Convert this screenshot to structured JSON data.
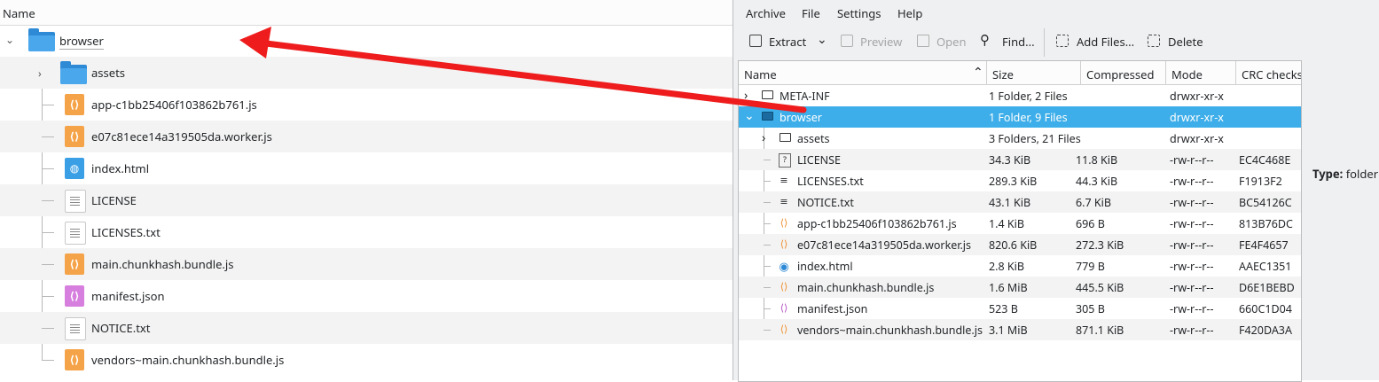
{
  "left_pane": {
    "header": "Name",
    "rows": [
      {
        "name": "browser",
        "kind": "folder"
      },
      {
        "name": "assets",
        "kind": "folder"
      },
      {
        "name": "app-c1bb25406f103862b761.js",
        "kind": "js"
      },
      {
        "name": "e07c81ece14a319505da.worker.js",
        "kind": "js"
      },
      {
        "name": "index.html",
        "kind": "html"
      },
      {
        "name": "LICENSE",
        "kind": "txt"
      },
      {
        "name": "LICENSES.txt",
        "kind": "txt"
      },
      {
        "name": "main.chunkhash.bundle.js",
        "kind": "js"
      },
      {
        "name": "manifest.json",
        "kind": "json"
      },
      {
        "name": "NOTICE.txt",
        "kind": "txt"
      },
      {
        "name": "vendors~main.chunkhash.bundle.js",
        "kind": "js"
      }
    ]
  },
  "ark": {
    "menu": [
      "Archive",
      "File",
      "Settings",
      "Help"
    ],
    "toolbar": {
      "extract": "Extract",
      "preview": "Preview",
      "open": "Open",
      "find": "Find...",
      "add_files": "Add Files...",
      "delete": "Delete"
    },
    "columns": [
      "Name",
      "Size",
      "Compressed",
      "Mode",
      "CRC checksu"
    ],
    "rows": [
      {
        "name": "META-INF",
        "size": "1 Folder, 2 Files",
        "compressed": "",
        "mode": "drwxr-xr-x",
        "crc": "",
        "kind": "folder"
      },
      {
        "name": "browser",
        "size": "1 Folder, 9 Files",
        "compressed": "",
        "mode": "drwxr-xr-x",
        "crc": "",
        "kind": "folder"
      },
      {
        "name": "assets",
        "size": "3 Folders, 21 Files",
        "compressed": "",
        "mode": "drwxr-xr-x",
        "crc": "",
        "kind": "folder"
      },
      {
        "name": "LICENSE",
        "size": "34.3 KiB",
        "compressed": "11.8 KiB",
        "mode": "-rw-r--r--",
        "crc": "EC4C468E",
        "kind": "unknown"
      },
      {
        "name": "LICENSES.txt",
        "size": "289.3 KiB",
        "compressed": "44.3 KiB",
        "mode": "-rw-r--r--",
        "crc": "F1913F2",
        "kind": "txt"
      },
      {
        "name": "NOTICE.txt",
        "size": "43.1 KiB",
        "compressed": "6.7 KiB",
        "mode": "-rw-r--r--",
        "crc": "BC54126C",
        "kind": "txt"
      },
      {
        "name": "app-c1bb25406f103862b761.js",
        "size": "1.4 KiB",
        "compressed": "696 B",
        "mode": "-rw-r--r--",
        "crc": "813B76DC",
        "kind": "js"
      },
      {
        "name": "e07c81ece14a319505da.worker.js",
        "size": "820.6 KiB",
        "compressed": "272.3 KiB",
        "mode": "-rw-r--r--",
        "crc": "FE4F4657",
        "kind": "js"
      },
      {
        "name": "index.html",
        "size": "2.8 KiB",
        "compressed": "779 B",
        "mode": "-rw-r--r--",
        "crc": "AAEC1351",
        "kind": "html"
      },
      {
        "name": "main.chunkhash.bundle.js",
        "size": "1.6 MiB",
        "compressed": "445.5 KiB",
        "mode": "-rw-r--r--",
        "crc": "D6E1BEBD",
        "kind": "js"
      },
      {
        "name": "manifest.json",
        "size": "523 B",
        "compressed": "305 B",
        "mode": "-rw-r--r--",
        "crc": "660C1D04",
        "kind": "json"
      },
      {
        "name": "vendors~main.chunkhash.bundle.js",
        "size": "3.1 MiB",
        "compressed": "871.1 KiB",
        "mode": "-rw-r--r--",
        "crc": "F420DA3A",
        "kind": "js"
      }
    ],
    "info_type_label": "Type:",
    "info_type_value": "folder"
  },
  "colors": {
    "selection": "#3daee9",
    "folder": "#2f8ad6",
    "js": "#f5a349",
    "json": "#d77fde",
    "html": "#3b9fe6",
    "arrow": "#ee1c1c"
  }
}
